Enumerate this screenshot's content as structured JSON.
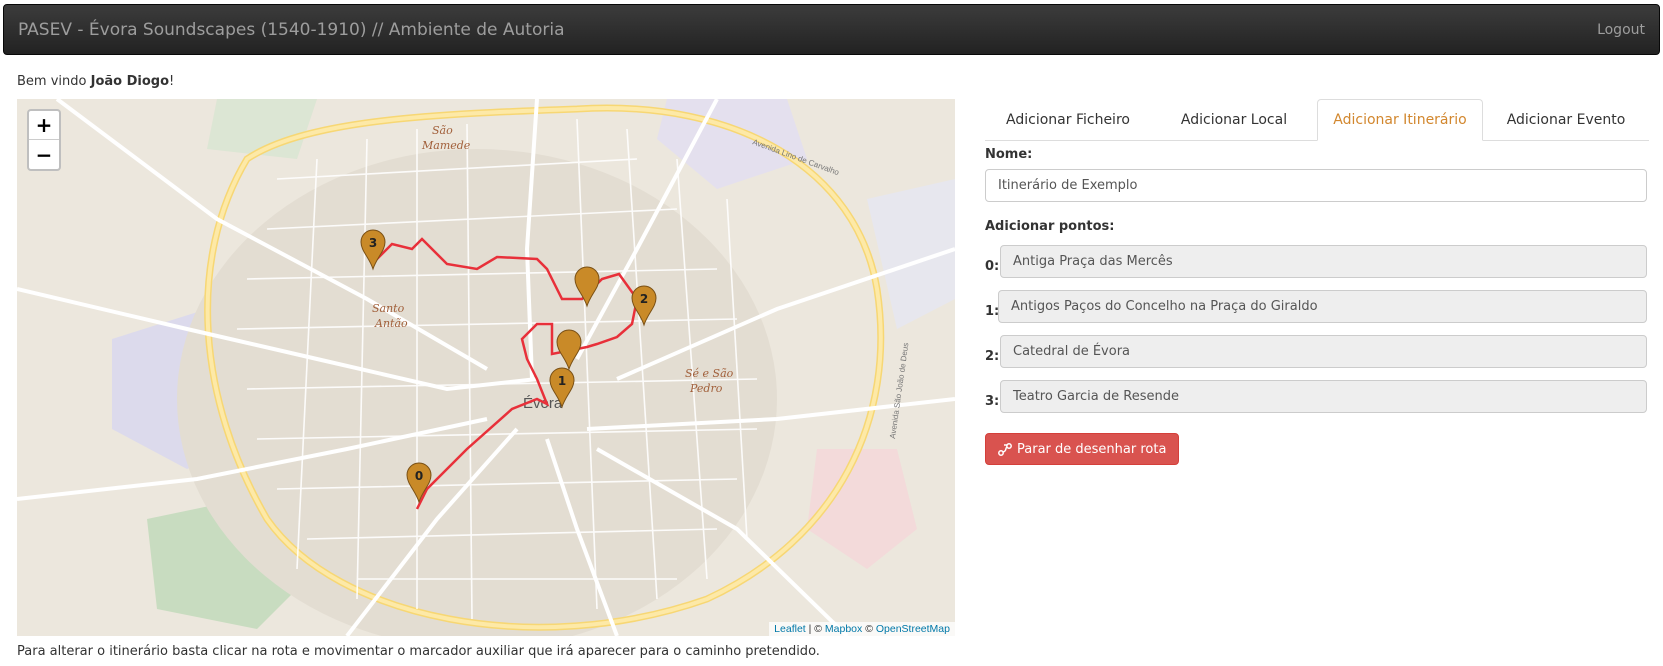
{
  "navbar": {
    "title": "PASEV - Évora Soundscapes (1540-1910) // Ambiente de Autoria",
    "logout": "Logout"
  },
  "welcome": {
    "prefix": "Bem vindo ",
    "user": "João Diogo",
    "suffix": "!"
  },
  "map": {
    "zoom_in": "+",
    "zoom_out": "−",
    "place_labels": {
      "sao_mamede_1": "São",
      "sao_mamede_2": "Mamede",
      "santo_antao_1": "Santo",
      "santo_antao_2": "Antão",
      "evora": "Évora",
      "se_sao_pedro_1": "Sé e São",
      "se_sao_pedro_2": "Pedro",
      "avenida_1": "Avenida São João de Deus",
      "avenida_2": "Avenida Lino de Carvalho"
    },
    "markers": [
      "0",
      "1",
      "2",
      "3"
    ],
    "attribution": {
      "leaflet": "Leaflet",
      "sep": " | © ",
      "mapbox": "Mapbox",
      "sep2": " © ",
      "osm": "OpenStreetMap"
    },
    "route_color": "#e8303a",
    "marker_color": "#c98a28"
  },
  "footnote": "Para alterar o itinerário basta clicar na rota e movimentar o marcador auxiliar que irá aparecer para o caminho pretendido.",
  "tabs": [
    {
      "label": "Adicionar Ficheiro"
    },
    {
      "label": "Adicionar Local"
    },
    {
      "label": "Adicionar Itinerário"
    },
    {
      "label": "Adicionar Evento"
    }
  ],
  "form": {
    "nome_label": "Nome:",
    "nome_value": "Itinerário de Exemplo",
    "pontos_label": "Adicionar pontos:",
    "points": [
      {
        "num": "0:",
        "value": "Antiga Praça das Mercês"
      },
      {
        "num": "1:",
        "value": "Antigos Paços do Concelho na Praça do Giraldo"
      },
      {
        "num": "2:",
        "value": "Catedral de Évora"
      },
      {
        "num": "3:",
        "value": "Teatro Garcia de Resende"
      }
    ],
    "stop_button": "Parar de desenhar rota"
  },
  "colors": {
    "accent": "#d2872e",
    "danger": "#d9534f"
  }
}
